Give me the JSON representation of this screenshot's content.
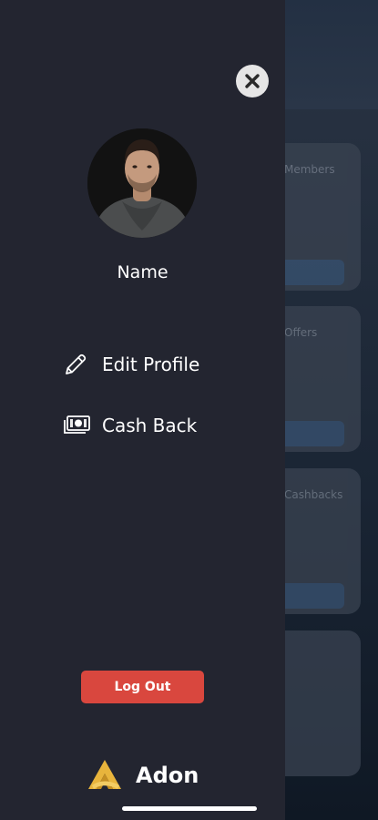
{
  "drawer": {
    "profile_name": "Name",
    "menu": [
      {
        "label": "Edit Profile",
        "icon": "pencil-icon"
      },
      {
        "label": "Cash Back",
        "icon": "cash-icon"
      }
    ],
    "logout_label": "Log Out",
    "close_icon": "close-icon"
  },
  "brand": {
    "name": "Adon",
    "logo_icon": "adon-logo-icon"
  },
  "colors": {
    "drawer_bg": "#232530",
    "logout_bg": "#d9473e",
    "brand_gold": "#e8b43c",
    "close_bg": "#e6e6e6"
  },
  "background": {
    "card_titles": [
      "Members",
      "Offers",
      "Cashbacks"
    ]
  }
}
